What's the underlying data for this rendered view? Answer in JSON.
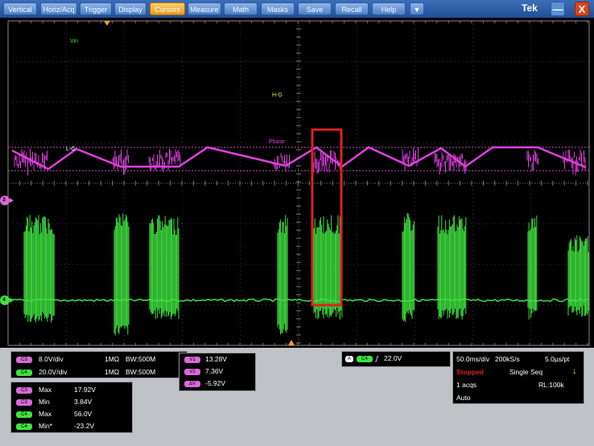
{
  "menu": {
    "items": [
      "Vertical",
      "Horiz/Acq",
      "Trigger",
      "Display",
      "Cursors",
      "Measure",
      "Math",
      "Masks",
      "Save",
      "Recall",
      "Help"
    ],
    "active": "Cursors",
    "dropdown_glyph": "▼",
    "brand": "Tek",
    "minimize_glyph": "—",
    "close_glyph": "X"
  },
  "waveform_labels": {
    "vin": "Vin",
    "hg": "H-G",
    "lg": "L-G",
    "phase": "Phase",
    "ch3_marker": "3",
    "ch4_marker": "4"
  },
  "channels": [
    {
      "name": "C3",
      "scale": "8.0V/div",
      "impedance": "1MΩ",
      "bandwidth": "BW:500M",
      "color": "#d86ad8"
    },
    {
      "name": "C4",
      "scale": "20.0V/div",
      "impedance": "1MΩ",
      "bandwidth": "BW:500M",
      "color": "#3fe23f"
    }
  ],
  "measurements": [
    {
      "src": "C3",
      "label": "Max",
      "value": "17.92V"
    },
    {
      "src": "C3",
      "label": "Min",
      "value": "3.84V"
    },
    {
      "src": "C4",
      "label": "Max",
      "value": "56.0V"
    },
    {
      "src": "C4",
      "label": "Min*",
      "value": "-23.2V"
    }
  ],
  "cursors": [
    {
      "label": "V1",
      "value": "13.28V"
    },
    {
      "label": "V2",
      "value": "7.36V"
    },
    {
      "label": "ΔV",
      "value": "-5.92V"
    }
  ],
  "trigger": {
    "mode_badge": "A",
    "source": "C4",
    "slope_glyph": "ʃ",
    "level": "22.0V"
  },
  "acquisition": {
    "timebase": "50.0ms/div",
    "sample_rate": "200kS/s",
    "resolution": "5.0µs/pt",
    "state": "Stopped",
    "sequence": "Single Seq",
    "acqs": "1 acqs",
    "record_length": "RL:100k",
    "mode": "Auto",
    "state_color": "#e02020"
  }
}
